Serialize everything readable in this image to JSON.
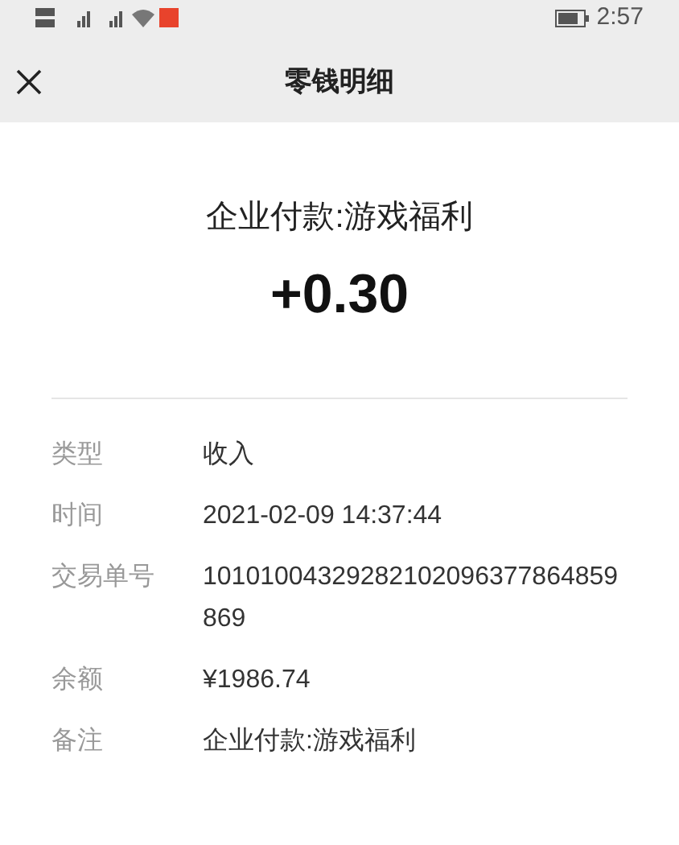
{
  "status_bar": {
    "time": "2:57"
  },
  "nav_bar": {
    "title": "零钱明细"
  },
  "transaction": {
    "title": "企业付款:游戏福利",
    "amount": "+0.30"
  },
  "details": [
    {
      "label": "类型",
      "value": "收入"
    },
    {
      "label": "时间",
      "value": "2021-02-09 14:37:44"
    },
    {
      "label": "交易单号",
      "value": "10101004329282102096377864859869"
    },
    {
      "label": "余额",
      "value": "¥1986.74"
    },
    {
      "label": "备注",
      "value": "企业付款:游戏福利"
    }
  ]
}
